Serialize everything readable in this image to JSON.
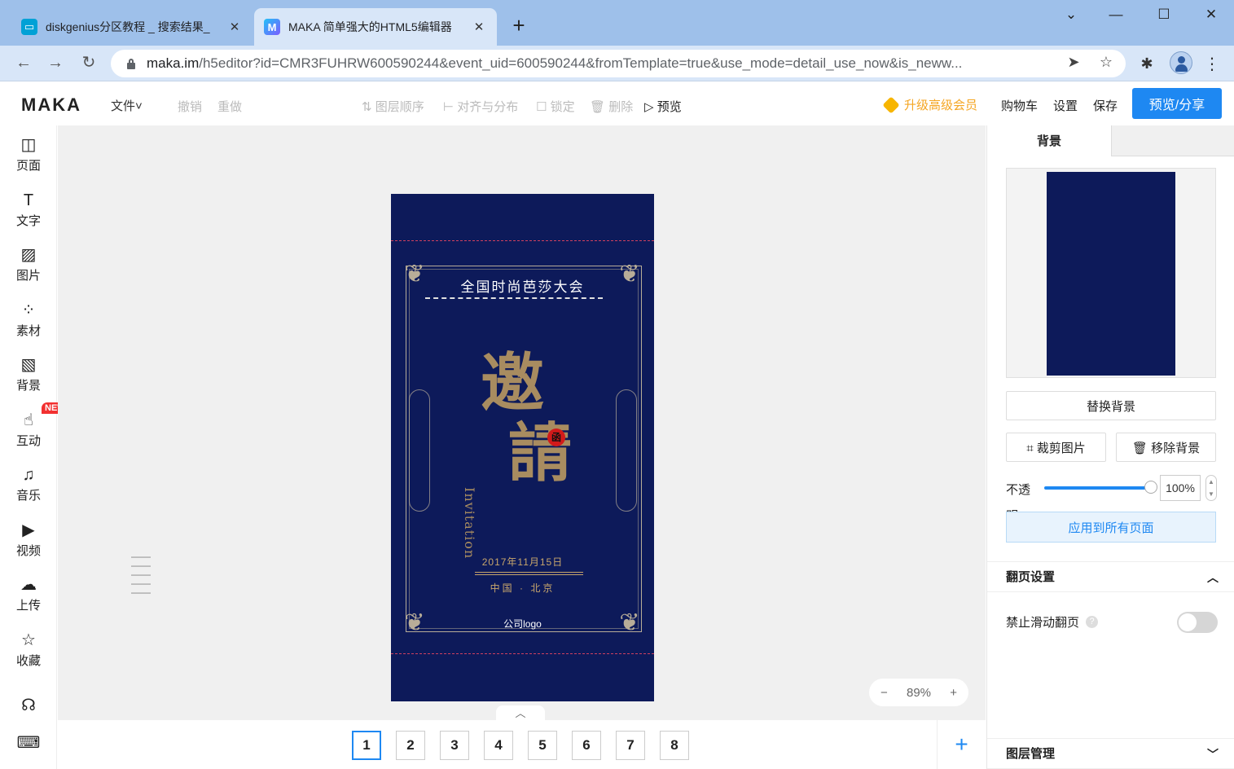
{
  "browser": {
    "tabs": [
      {
        "title": "diskgenius分区教程 _ 搜索结果_",
        "icon": "bilibili-icon"
      },
      {
        "title": "MAKA 简单强大的HTML5编辑器",
        "icon": "maka-icon",
        "favicon_letter": "M"
      }
    ],
    "new_tab": "+",
    "url_host": "maka.im",
    "url_rest": "/h5editor?id=CMR3FUHRW600590244&event_uid=600590244&fromTemplate=true&use_mode=detail_use_now&is_neww..."
  },
  "app": {
    "logo": "MAKA",
    "file_menu": "文件˅",
    "toolbar": {
      "undo": "撤销",
      "redo": "重做",
      "layer_order": "⇅ 图层顺序",
      "align": "⊢ 对齐与分布",
      "lock": "☐ 锁定",
      "delete": "🗑 删除",
      "preview": "▷ 预览"
    },
    "vip": "升级高级会员",
    "cart": "购物车",
    "settings": "设置",
    "save": "保存",
    "share": "预览/分享",
    "accent": "#1e88f2"
  },
  "sidebar": {
    "items": [
      {
        "label": "页面",
        "icon": "layout-icon",
        "glyph": "◫"
      },
      {
        "label": "文字",
        "icon": "text-icon",
        "glyph": "T"
      },
      {
        "label": "图片",
        "icon": "image-icon",
        "glyph": "▨"
      },
      {
        "label": "素材",
        "icon": "elements-icon",
        "glyph": "⁘"
      },
      {
        "label": "背景",
        "icon": "background-icon",
        "glyph": "▧"
      },
      {
        "label": "互动",
        "icon": "interaction-icon",
        "glyph": "☝"
      },
      {
        "label": "音乐",
        "icon": "music-icon",
        "glyph": "♫"
      },
      {
        "label": "视频",
        "icon": "video-icon",
        "glyph": "▶"
      },
      {
        "label": "上传",
        "icon": "upload-icon",
        "glyph": "☁"
      },
      {
        "label": "收藏",
        "icon": "star-icon",
        "glyph": "☆"
      }
    ],
    "new_badge": "NEW",
    "support_glyph": "☊",
    "keyboard_glyph": "⌨"
  },
  "poster": {
    "title": "全国时尚芭莎大会",
    "calligraphy_1": "邀",
    "calligraphy_2": "請",
    "seal": "函",
    "invitation": "Invitation",
    "date": "2017年11月15日",
    "location": "中国 · 北京",
    "logo_text": "公司logo",
    "background_color": "#0d1a5a"
  },
  "canvas": {
    "zoom_out": "−",
    "zoom": "89%",
    "zoom_in": "+",
    "collapse": "︿"
  },
  "pages": {
    "items": [
      "1",
      "2",
      "3",
      "4",
      "5",
      "6",
      "7",
      "8"
    ],
    "selected": "1",
    "add": "+"
  },
  "panel": {
    "tab_background": "背景",
    "replace_bg": "替换背景",
    "crop": "⌗ 裁剪图片",
    "remove_bg": "🗑 移除背景",
    "opacity_label": "不透",
    "opacity_label_2": "明",
    "opacity_value": "100%",
    "apply_all": "应用到所有页面",
    "page_turn_section": "翻页设置",
    "disable_swipe": "禁止滑动翻页",
    "layer_section": "图层管理",
    "chev_up": "︿",
    "chev_down": "﹀"
  }
}
